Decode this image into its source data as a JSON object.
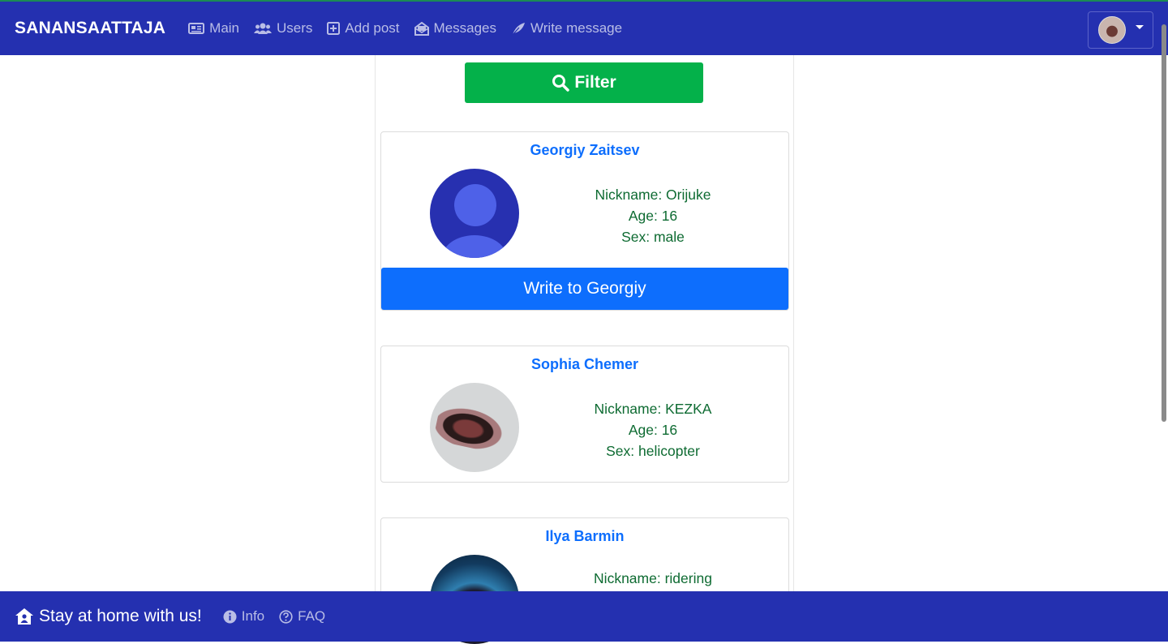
{
  "navbar": {
    "brand": "SANANSAATTAJA",
    "items": [
      {
        "label": "Main",
        "icon": "newspaper-icon"
      },
      {
        "label": "Users",
        "icon": "users-icon"
      },
      {
        "label": "Add post",
        "icon": "plus-square-icon"
      },
      {
        "label": "Messages",
        "icon": "envelope-open-icon"
      },
      {
        "label": "Write message",
        "icon": "feather-icon"
      }
    ]
  },
  "filter": {
    "label": "Filter"
  },
  "users": [
    {
      "name": "Georgiy Zaitsev",
      "nickname": "Nickname: Orijuke",
      "age": "Age: 16",
      "sex": "Sex: male",
      "write_label": "Write to Georgiy"
    },
    {
      "name": "Sophia Chemer",
      "nickname": "Nickname: KEZKA",
      "age": "Age: 16",
      "sex": "Sex: helicopter"
    },
    {
      "name": "Ilya Barmin",
      "nickname": "Nickname: ridering"
    }
  ],
  "footer": {
    "title": "Stay at home with us!",
    "links": [
      {
        "label": "Info",
        "icon": "info-circle-icon"
      },
      {
        "label": "FAQ",
        "icon": "question-circle-icon"
      }
    ]
  },
  "colors": {
    "navbar": "#2430b0",
    "filter_button": "#04b14a",
    "primary": "#0d6efd",
    "info_text": "#0e6b32"
  }
}
